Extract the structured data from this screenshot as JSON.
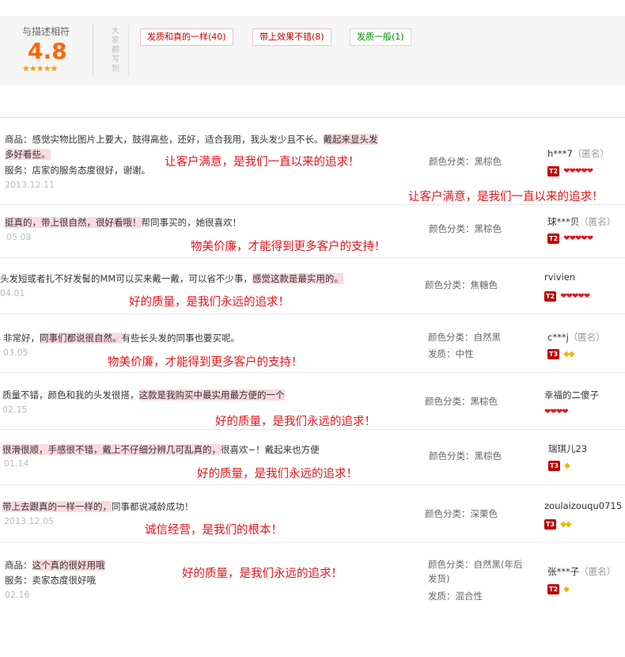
{
  "summary": {
    "label": "与描述相符",
    "score": "4.8",
    "stars": "★★★★★",
    "side_label": "大家都写到",
    "tags": [
      {
        "text": "发质和真的一样(40)"
      },
      {
        "text": "带上效果不错(8)"
      },
      {
        "text": "发质一般(1)"
      }
    ]
  },
  "reviews": [
    {
      "line1_prefix": "商品：感觉实物比图片上要大，鼓得高些，还好，适合我用，我头发少且不长。",
      "line1_hl": "戴起来显头发",
      "line2_hl": "多好看些。",
      "line3": "服务：店家的服务态度很好，谢谢。",
      "date": "2013.12.11",
      "overlay1": "让客户满意，是我们一直以来的追求！",
      "overlay2": "让客户满意，是我们一直以来的追求！",
      "prop1": "颜色分类：黑棕色",
      "user": "h***7",
      "anon": "（匿名）",
      "level": "T2",
      "hearts": "❤❤❤❤❤"
    },
    {
      "line1_hl": "挺真的，带上很自然，很好看哦！",
      "line1_rest": "帮同事买的，她很喜欢！",
      "date": "05.08",
      "overlay1": "物美价廉，才能得到更多客户的支持！",
      "prop1": "颜色分类：黑棕色",
      "user": "球***贝",
      "anon": "（匿名）",
      "level": "T2",
      "hearts": "❤❤❤❤❤"
    },
    {
      "line1_prefix": "头发短或者扎不好发髻的MM可以买来戴一戴，可以省不少事，",
      "line1_hl": "感觉这款是最实用的。",
      "date": "04.01",
      "overlay1": "好的质量，是我们永远的追求！",
      "prop1": "颜色分类：焦糖色",
      "user": "rvivien",
      "level": "T2",
      "hearts": "❤❤❤❤❤"
    },
    {
      "line1_prefix": "非常好，",
      "line1_hl": "同事们都说很自然。",
      "line1_rest": "有些长头发的同事也要买呢。",
      "date": "03.05",
      "overlay1": "物美价廉，才能得到更多客户的支持！",
      "prop1": "颜色分类：自然黑",
      "prop2": "发质：中性",
      "user": "c***j",
      "anon": "（匿名）",
      "level": "T3",
      "dias": "◆◆"
    },
    {
      "line1_prefix": "质量不错，颜色和我的头发很搭，",
      "line1_hl": "这款是我购买中最实用最方便的一个",
      "date": "02.15",
      "overlay1": "好的质量，是我们永远的追求！",
      "prop1": "颜色分类：黑棕色",
      "user": "幸福的二傻子",
      "hearts": "❤❤❤❤"
    },
    {
      "line1_hl": "很滑很顺，手感很不错，戴上不仔细分辨几可乱真的，",
      "line1_rest": "很喜欢~！戴起来也方便",
      "date": "01.14",
      "overlay1": "好的质量，是我们永远的追求！",
      "prop1": "颜色分类：黑棕色",
      "user": "瑞琪儿23",
      "level": "T3",
      "dias": "◆"
    },
    {
      "line1_hl": "带上去跟真的一样一样的，",
      "line1_rest": "同事都说减龄成功！",
      "date": "2013.12.05",
      "overlay1": "诚信经营，是我们的根本！",
      "prop1": "颜色分类：深栗色",
      "user": "zoulaizouqu0715",
      "level": "T3",
      "dias": "◆◆"
    },
    {
      "line1_prefix": "商品：",
      "line1_hl": "这个真的很好用哦",
      "line3": "服务：卖家态度很好哦",
      "date": "02.16",
      "overlay1": "好的质量，是我们永远的追求！",
      "prop1a": "颜色分类：自然黑(年后",
      "prop1b": "发货)",
      "prop2": "发质：混合性",
      "user": "张***子",
      "anon": "（匿名）",
      "level": "T2",
      "dias": "◆"
    }
  ]
}
